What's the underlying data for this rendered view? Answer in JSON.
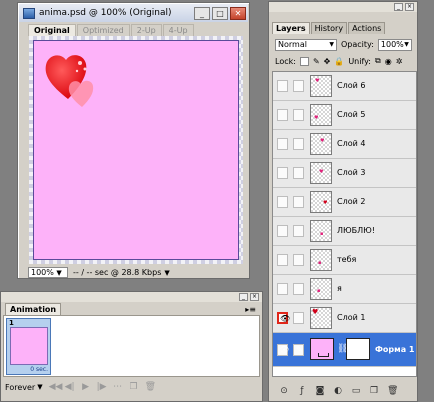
{
  "document": {
    "title": "anima.psd @ 100% (Original)",
    "window_buttons": [
      "_",
      "□",
      "✕"
    ],
    "tabs": [
      "Original",
      "Optimized",
      "2-Up",
      "4-Up"
    ],
    "canvas_color": "#fdb2f9",
    "zoom": "100%",
    "status": "-- / -- sec @ 28.8 Kbps"
  },
  "animation": {
    "tab": "Animation",
    "frame_number": "1",
    "frame_delay": "0 sec.",
    "loop": "Forever",
    "controls": [
      "◀◀",
      "◀|",
      "▶",
      "|▶"
    ],
    "footer_icons": [
      "tween-icon",
      "duplicate-frame-icon",
      "delete-frame-icon"
    ]
  },
  "layers": {
    "tabs": [
      "Layers",
      "History",
      "Actions"
    ],
    "blend_mode": "Normal",
    "opacity_label": "Opacity:",
    "opacity_value": "100%",
    "lock_label": "Lock:",
    "unify_label": "Unify:",
    "items": [
      {
        "name": "Слой 6",
        "visible": false
      },
      {
        "name": "Слой 5",
        "visible": false
      },
      {
        "name": "Слой 4",
        "visible": false
      },
      {
        "name": "Слой 3",
        "visible": false
      },
      {
        "name": "Слой 2",
        "visible": false
      },
      {
        "name": "ЛЮБЛЮ!",
        "visible": false
      },
      {
        "name": "тебя",
        "visible": false
      },
      {
        "name": "я",
        "visible": false
      },
      {
        "name": "Слой 1",
        "visible": true
      },
      {
        "name": "Форма 1",
        "visible": true,
        "selected": true
      }
    ],
    "selected_color": "#3973d8"
  }
}
